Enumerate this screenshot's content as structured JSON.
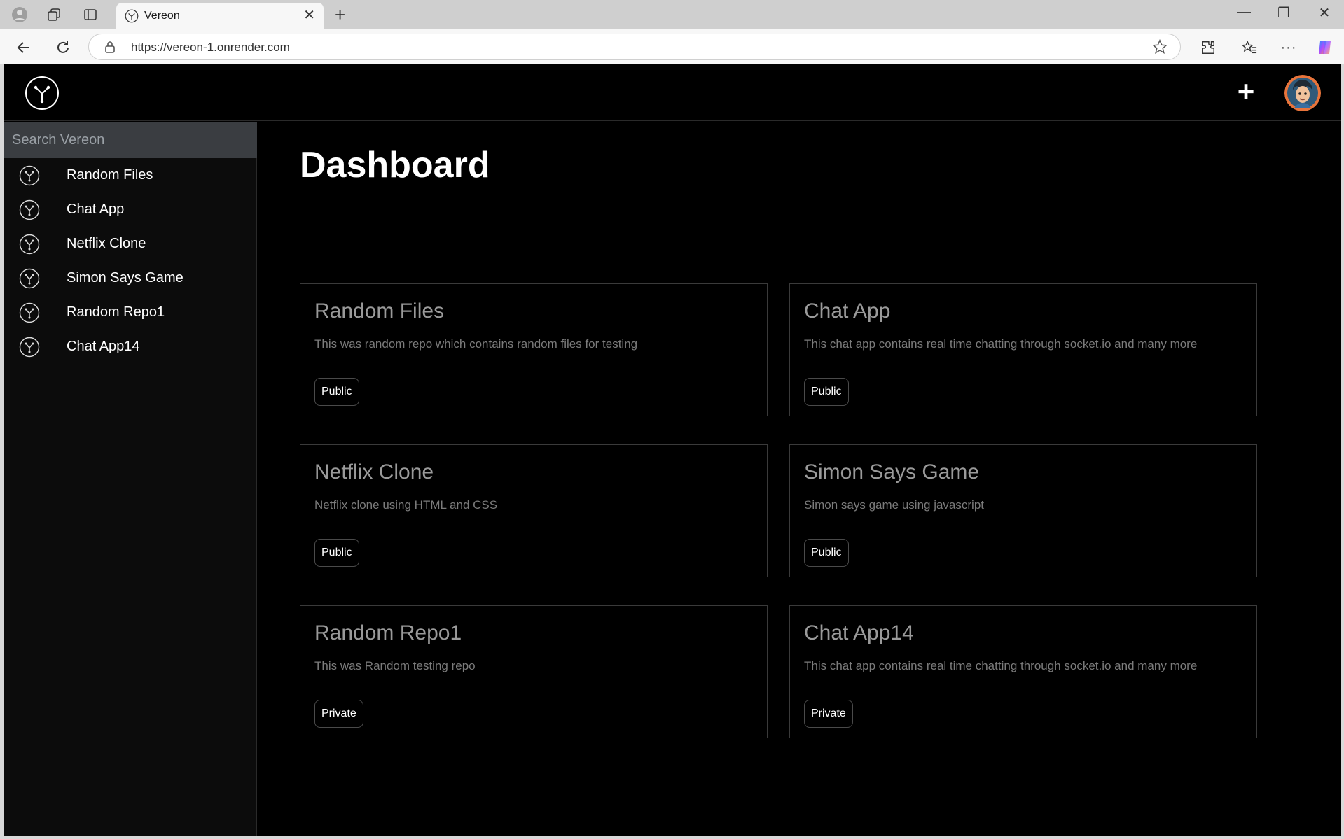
{
  "browser": {
    "tab_title": "Vereon",
    "url": "https://vereon-1.onrender.com"
  },
  "search": {
    "placeholder": "Search Vereon"
  },
  "sidebar": {
    "items": [
      {
        "label": "Random Files"
      },
      {
        "label": "Chat App"
      },
      {
        "label": "Netflix Clone"
      },
      {
        "label": "Simon Says Game"
      },
      {
        "label": "Random Repo1"
      },
      {
        "label": "Chat App14"
      }
    ]
  },
  "main": {
    "title": "Dashboard",
    "cards": [
      {
        "title": "Random Files",
        "description": "This was random repo which contains random files for testing",
        "visibility": "Public"
      },
      {
        "title": "Chat App",
        "description": "This chat app contains real time chatting through socket.io and many more",
        "visibility": "Public"
      },
      {
        "title": "Netflix Clone",
        "description": "Netflix clone using HTML and CSS",
        "visibility": "Public"
      },
      {
        "title": "Simon Says Game",
        "description": "Simon says game using javascript",
        "visibility": "Public"
      },
      {
        "title": "Random Repo1",
        "description": "This was Random testing repo",
        "visibility": "Private"
      },
      {
        "title": "Chat App14",
        "description": "This chat app contains real time chatting through socket.io and many more",
        "visibility": "Private"
      }
    ]
  },
  "colors": {
    "background": "#000000",
    "sidebar": "#0c0c0c",
    "search_bg": "#3a3d41",
    "card_title": "#9a9a9a",
    "card_desc": "#7b7b7b"
  },
  "icons": {
    "logo": "vereon-logo-icon",
    "repo": "repo-fork-icon",
    "add": "plus-icon",
    "user": "avatar"
  }
}
